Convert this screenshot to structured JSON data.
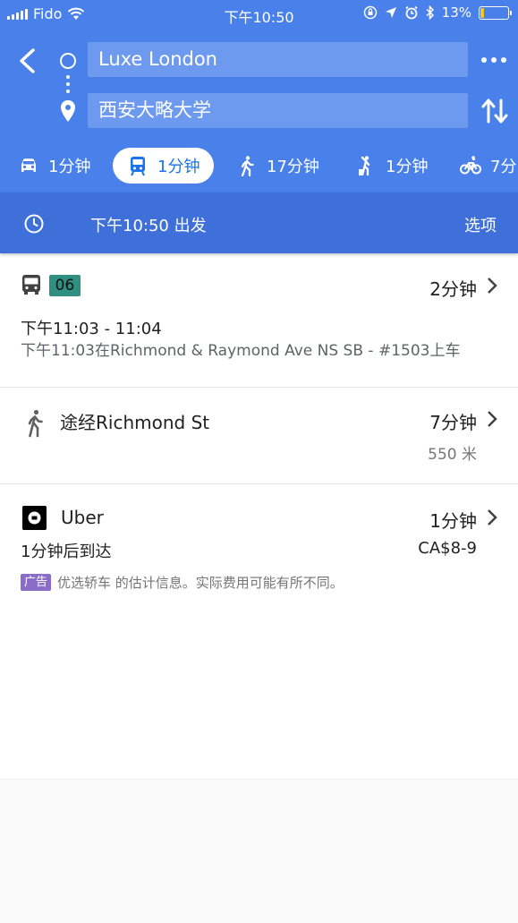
{
  "status_bar": {
    "carrier": "Fido",
    "time": "下午10:50",
    "battery_percent": "13%",
    "battery_level": 0.13
  },
  "search": {
    "origin": "Luxe London",
    "destination": "西安大略大学"
  },
  "modes": [
    {
      "icon": "car-icon",
      "label": "1分钟"
    },
    {
      "icon": "train-icon",
      "label": "1分钟",
      "active": true
    },
    {
      "icon": "walk-icon",
      "label": "17分钟"
    },
    {
      "icon": "rideshare-icon",
      "label": "1分钟"
    },
    {
      "icon": "bike-icon",
      "label": "7分"
    }
  ],
  "departure": {
    "text": "下午10:50 出发",
    "options_label": "选项"
  },
  "transit": {
    "route_number": "06",
    "duration": "2分钟",
    "time_range": "下午11:03 - 11:04",
    "boarding": "下午11:03在Richmond & Raymond Ave NS SB - #1503上车",
    "badge_color": "#2f8f80"
  },
  "walk": {
    "label": "途经Richmond St",
    "duration": "7分钟",
    "distance": "550 米"
  },
  "uber": {
    "name": "Uber",
    "duration": "1分钟",
    "arrival": "1分钟后到达",
    "price": "CA$8-9",
    "ad_badge": "广告",
    "ad_text": "优选轿车 的估计信息。实际费用可能有所不同。",
    "ad_color": "#8c6cc9"
  },
  "colors": {
    "header": "#4a80ea",
    "depart_bar": "#3f6fd8",
    "active_tab_text": "#1a73e8"
  }
}
